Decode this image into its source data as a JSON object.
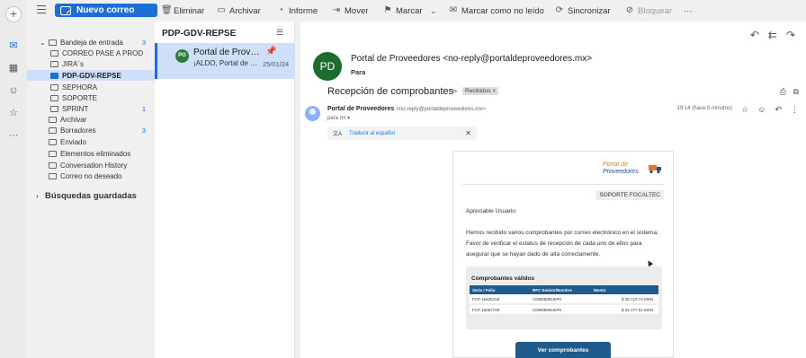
{
  "toolbar": {
    "new_mail": "Nuevo correo",
    "items": [
      {
        "label": "Eliminar",
        "icon": "trash-icon"
      },
      {
        "label": "Archivar",
        "icon": "archive-icon"
      },
      {
        "label": "Informe",
        "icon": "report-icon"
      },
      {
        "label": "Mover",
        "icon": "move-icon"
      },
      {
        "label": "Marcar",
        "icon": "flag-icon"
      },
      {
        "label": "Marcar como no leído",
        "icon": "envelope-icon"
      },
      {
        "label": "Sincronizar",
        "icon": "sync-icon"
      },
      {
        "label": "Bloquear",
        "icon": "block-icon"
      }
    ],
    "more": "···"
  },
  "folders": [
    {
      "label": "Bandeja de entrada",
      "count": "3",
      "icon": "inbox-icon"
    },
    {
      "label": "CORREO PASE A PROD",
      "count": "",
      "icon": "folder-icon"
    },
    {
      "label": "JIRA´s",
      "count": "",
      "icon": "folder-icon"
    },
    {
      "label": "PDP-GDV-REPSE",
      "count": "",
      "icon": "folder-icon",
      "selected": true
    },
    {
      "label": "SEPHORA",
      "count": "",
      "icon": "folder-icon"
    },
    {
      "label": "SOPORTE",
      "count": "",
      "icon": "folder-icon"
    },
    {
      "label": "SPRINT",
      "count": "1",
      "icon": "folder-icon"
    },
    {
      "label": "Archivar",
      "count": "",
      "icon": "archive-icon"
    },
    {
      "label": "Borradores",
      "count": "3",
      "icon": "draft-icon"
    },
    {
      "label": "Enviado",
      "count": "",
      "icon": "send-icon"
    },
    {
      "label": "Elementos eliminados",
      "count": "",
      "icon": "trash-icon"
    },
    {
      "label": "Conversation History",
      "count": "",
      "icon": "folder-icon"
    },
    {
      "label": "Correo no deseado",
      "count": "",
      "icon": "junk-icon"
    }
  ],
  "saved_searches": "Búsquedas guardadas",
  "list": {
    "title": "PDP-GDV-REPSE",
    "item": {
      "avatar": "PO",
      "sender": "Portal de Proveedores",
      "preview": "¡ALDO, Portal de Provee...",
      "date": "25/01/24"
    }
  },
  "reading": {
    "avatar": "PD",
    "from": "Portal de Proveedores <no-reply@portaldeproveedores.mx>",
    "to_label": "Para"
  },
  "gmail": {
    "subject": "Recepción de comprobantes",
    "label": "Recibidos ×",
    "sender_name": "Portal de Proveedores",
    "sender_email": "<no-reply@portaldeproveedores.mx>",
    "to": "para mí ▾",
    "time": "19:14 (hace 0 minutos)",
    "translate": "Traducir al español"
  },
  "email": {
    "logo_line1": "Portal de",
    "logo_line2": "Proveedores",
    "soporte": "SOPORTE FOCALTEC",
    "greeting": "Apreciable Usuario:",
    "body": "Hemos recibido varios comprobantes por correo electrónico en el sistema. Favor de verificar el estatus de recepción de cada uno de ellos para asegurar que se hayan dado de alta correctamente.",
    "table_title": "Comprobantes válidos",
    "columns": [
      "Serie / Folio",
      "RFC Emisor/Nombre",
      "Monto"
    ],
    "rows": [
      [
        "FCP 16425418",
        "CDM060815IP6",
        "$ 36,710.74 MXN"
      ],
      [
        "FCP 16067749",
        "CDM060815IP6",
        "$ 32,777.51 MXN"
      ]
    ],
    "button": "Ver comprobantes"
  }
}
